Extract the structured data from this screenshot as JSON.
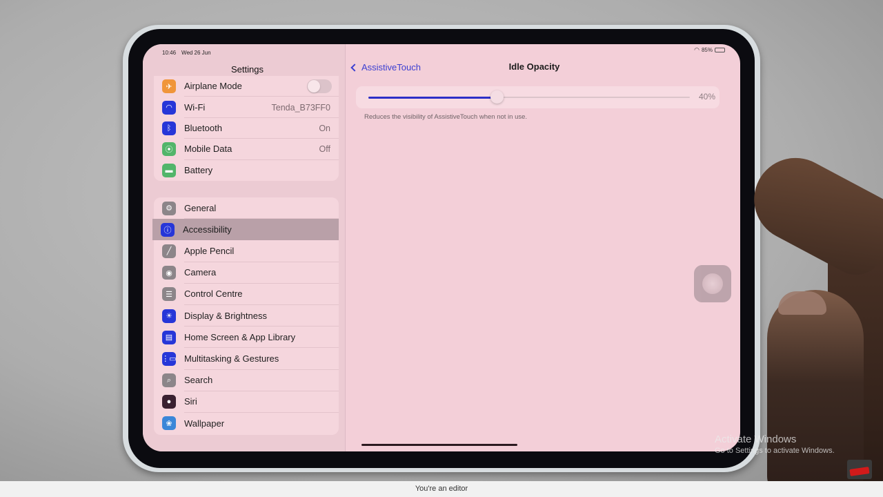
{
  "status_bar": {
    "time": "10:46",
    "date": "Wed 26 Jun",
    "battery_percent": "85%",
    "battery_level": 0.85
  },
  "sidebar": {
    "title": "Settings",
    "group1": [
      {
        "label": "Airplane Mode",
        "icon": "airplane-icon",
        "color": "#f0953a",
        "glyph": "✈",
        "toggle": false
      },
      {
        "label": "Wi-Fi",
        "icon": "wifi-icon",
        "color": "#2636d8",
        "glyph": "◠",
        "value": "Tenda_B73FF0"
      },
      {
        "label": "Bluetooth",
        "icon": "bluetooth-icon",
        "color": "#2636d8",
        "glyph": "ᛒ",
        "value": "On"
      },
      {
        "label": "Mobile Data",
        "icon": "antenna-icon",
        "color": "#52b56a",
        "glyph": "⦿",
        "value": "Off"
      },
      {
        "label": "Battery",
        "icon": "battery-icon",
        "color": "#52b56a",
        "glyph": "▬"
      }
    ],
    "group2": [
      {
        "label": "General",
        "icon": "gear-icon",
        "color": "#8c8589",
        "glyph": "⚙"
      },
      {
        "label": "Accessibility",
        "icon": "accessibility-icon",
        "color": "#2636d8",
        "glyph": "ⓘ",
        "selected": true
      },
      {
        "label": "Apple Pencil",
        "icon": "pencil-icon",
        "color": "#8c8589",
        "glyph": "╱"
      },
      {
        "label": "Camera",
        "icon": "camera-icon",
        "color": "#8c8589",
        "glyph": "◉"
      },
      {
        "label": "Control Centre",
        "icon": "toggles-icon",
        "color": "#8c8589",
        "glyph": "☰"
      },
      {
        "label": "Display & Brightness",
        "icon": "sun-icon",
        "color": "#2636d8",
        "glyph": "☀"
      },
      {
        "label": "Home Screen & App Library",
        "icon": "home-screen-icon",
        "color": "#2636d8",
        "glyph": "▤"
      },
      {
        "label": "Multitasking & Gestures",
        "icon": "multitasking-icon",
        "color": "#2636d8",
        "glyph": "⋮▭"
      },
      {
        "label": "Search",
        "icon": "search-icon",
        "color": "#8c8589",
        "glyph": "⌕"
      },
      {
        "label": "Siri",
        "icon": "siri-icon",
        "color": "#3a2030",
        "glyph": "●"
      },
      {
        "label": "Wallpaper",
        "icon": "flower-icon",
        "color": "#3a86d8",
        "glyph": "❀"
      }
    ]
  },
  "detail": {
    "back_label": "AssistiveTouch",
    "title": "Idle Opacity",
    "slider_value": 0.4,
    "slider_label": "40%",
    "footnote": "Reduces the visibility of AssistiveTouch when not in use."
  },
  "overlay": {
    "watermark_title": "Activate Windows",
    "watermark_sub": "Go to Settings to activate Windows.",
    "bottom_bar_text": "You're an editor"
  }
}
